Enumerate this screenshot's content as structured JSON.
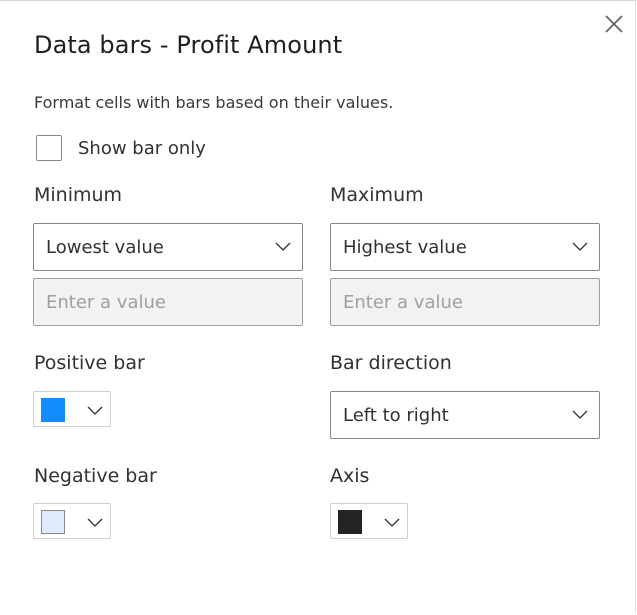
{
  "dialog": {
    "title": "Data bars - Profit Amount",
    "description": "Format cells with bars based on their values.",
    "close_icon": "close-icon"
  },
  "show_bar_only": {
    "label": "Show bar only",
    "checked": false
  },
  "minimum": {
    "label": "Minimum",
    "selected": "Lowest value",
    "input_placeholder": "Enter a value",
    "input_value": ""
  },
  "maximum": {
    "label": "Maximum",
    "selected": "Highest value",
    "input_placeholder": "Enter a value",
    "input_value": ""
  },
  "positive_bar": {
    "label": "Positive bar",
    "color": "#118dff"
  },
  "negative_bar": {
    "label": "Negative bar",
    "color": "#ddebfb"
  },
  "bar_direction": {
    "label": "Bar direction",
    "selected": "Left to right"
  },
  "axis": {
    "label": "Axis",
    "color": "#252423"
  }
}
